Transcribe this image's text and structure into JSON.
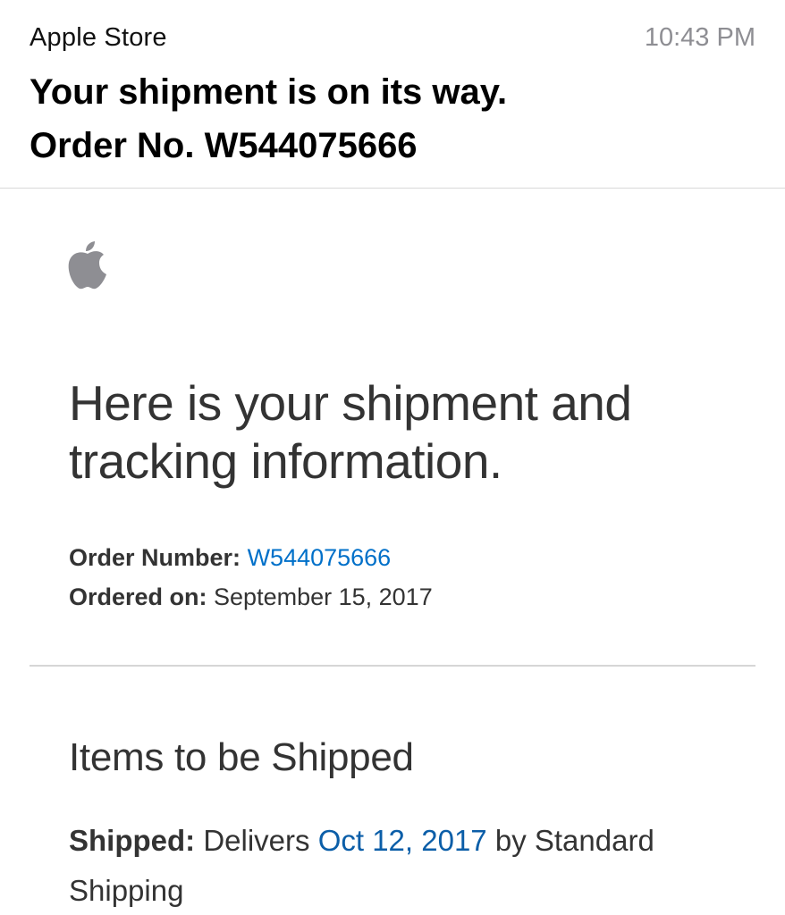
{
  "mail": {
    "sender": "Apple Store",
    "time": "10:43 PM",
    "subject_line1": "Your shipment is on its way.",
    "subject_line2": "Order No. W544075666"
  },
  "logo": {
    "icon": "apple-logo-icon",
    "color": "#8e8e93"
  },
  "body": {
    "headline_line1": "Here is your shipment and",
    "headline_line2": "tracking information.",
    "order_number_label": "Order Number:",
    "order_number_value": "W544075666",
    "ordered_on_label": "Ordered on:",
    "ordered_on_value": "September 15, 2017",
    "section_title": "Items to be Shipped",
    "shipped_label": "Shipped:",
    "delivers_prefix": "Delivers",
    "delivery_date": "Oct 12, 2017",
    "shipping_method": "by Standard Shipping"
  },
  "colors": {
    "link": "#0070c9",
    "secondary_text": "#8e8e93",
    "body_text": "#333333"
  }
}
